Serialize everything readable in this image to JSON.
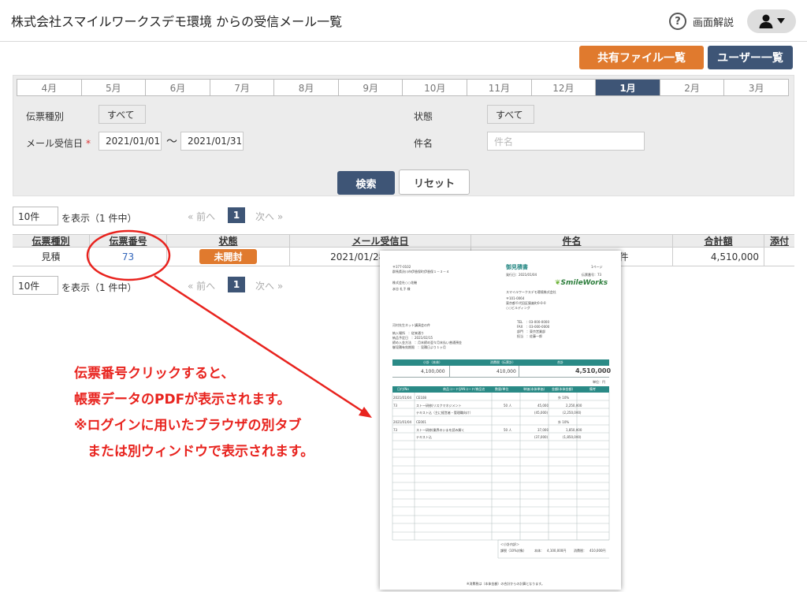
{
  "header": {
    "title": "株式会社スマイルワークスデモ環境 からの受信メール一覧",
    "help_label": "画面解説",
    "shared_files_label": "共有ファイル一覧",
    "user_list_label": "ユーザー一覧"
  },
  "filter": {
    "months": [
      "4月",
      "5月",
      "6月",
      "7月",
      "8月",
      "9月",
      "10月",
      "11月",
      "12月",
      "1月",
      "2月",
      "3月"
    ],
    "active_month": "1月",
    "slip_type_label": "伝票種別",
    "slip_type_value": "すべて",
    "status_label": "状態",
    "status_value": "すべて",
    "mail_date_label": "メール受信日",
    "required_mark": "*",
    "date_from": "2021/01/01",
    "date_sep": "〜",
    "date_to": "2021/01/31",
    "subject_label": "件名",
    "subject_placeholder": "件名",
    "search_label": "検索",
    "reset_label": "リセット"
  },
  "pager": {
    "per_page": "10件",
    "count_text": "を表示（1 件中）",
    "prev": "«  前へ",
    "page": "1",
    "next": "次へ  »"
  },
  "table": {
    "headers": {
      "slip_type": "伝票種別",
      "slip_no": "伝票番号",
      "status": "状態",
      "received": "メール受信日",
      "subject": "件名",
      "total": "合計額",
      "attach": "添付"
    },
    "rows": [
      {
        "slip_type": "見積",
        "slip_no": "73",
        "status": "未開封",
        "received": "2021/01/28 21:15:45",
        "subject": "河村先生ネット講演会の件",
        "total": "4,510,000"
      }
    ]
  },
  "annotation": {
    "line1": "伝票番号クリックすると、",
    "line2": "帳票データのPDFが表示されます。",
    "line3": "※ログインに用いたブラウザの別タブ",
    "line4": "　または別ウィンドウで表示されます。"
  },
  "pdf": {
    "title": "御見積書",
    "page": "1ページ",
    "issue_date": "発行日：2021/01/04",
    "slip_no": "伝票番号：73",
    "postal": "〒377-0102",
    "addr": "群馬県渋川市伊香保町伊香保１－３－４",
    "client": "株式会社○○花機",
    "person": "氷谷 礼子 様",
    "logo": "SmileWorks",
    "company": "スマイルワークスデモ環境株式会社",
    "co_postal": "〒101-0064",
    "co_addr": "東京都千代田区猿楽町0-0-0",
    "co_bldg": "○○ビルディング",
    "tel": "TEL　：03-000-0000",
    "fax": "FAX　：03-000-0000",
    "dept": "部門　：東京営業部",
    "rep": "担当　：佐藤一郎",
    "subject": "河村先生ネット講演会の件",
    "delivery_place": "納入場所　：従来通り",
    "delivery_date": "納品予定日　：2021/02/15",
    "pay_terms": "締め入金方法　：月末締め翌々月末払い普通預金",
    "valid": "御見積有効期限　：見積日より１ヶ月",
    "sum_head1": "小計（本体）",
    "sum_head2": "消費税（伝票計）",
    "sum_head3": "合計",
    "subtotal": "4,100,000",
    "tax": "410,000",
    "grand_total": "4,510,000",
    "unit_yen": "単位：円",
    "col_date": "日付/No",
    "col_item": "商品コード/JANコード/商品名",
    "col_qty": "数量/単位",
    "col_price": "単価(本体単価)",
    "col_amount": "金額(本体金額)",
    "col_note": "備考",
    "l1_date": "2021/01/04",
    "l1_code": "CE108",
    "l1_tax": "外 10%",
    "l1_no": "73",
    "l1_name": "ストー研修(リスクマネジメント",
    "l1_qty": "50 人",
    "l1_price": "45,000",
    "l1_amount": "2,250,000",
    "l1_text": "テキスト込（主に経営者・管理職向け）",
    "l1_price2": "(45,000)",
    "l1_amount2": "(2,250,000)",
    "l2_date": "2021/01/04",
    "l2_code": "CE001",
    "l2_tax": "外 10%",
    "l2_no": "73",
    "l2_name": "ストー研修(業界のいまを読み解く",
    "l2_qty": "50 人",
    "l2_price": "37,000",
    "l2_amount": "1,850,000",
    "l2_text": "テキスト込",
    "l2_price2": "(37,000)",
    "l2_amount2": "(1,850,000)",
    "tax_breakdown": "＜小計内訳＞",
    "tax_line1": "課税（10%対象）",
    "tax_line2": "本体：　4,100,000円",
    "tax_line3": "消費税：　410,000円",
    "footer": "※消費税は（本体金額）の合計からの計算となります。"
  }
}
